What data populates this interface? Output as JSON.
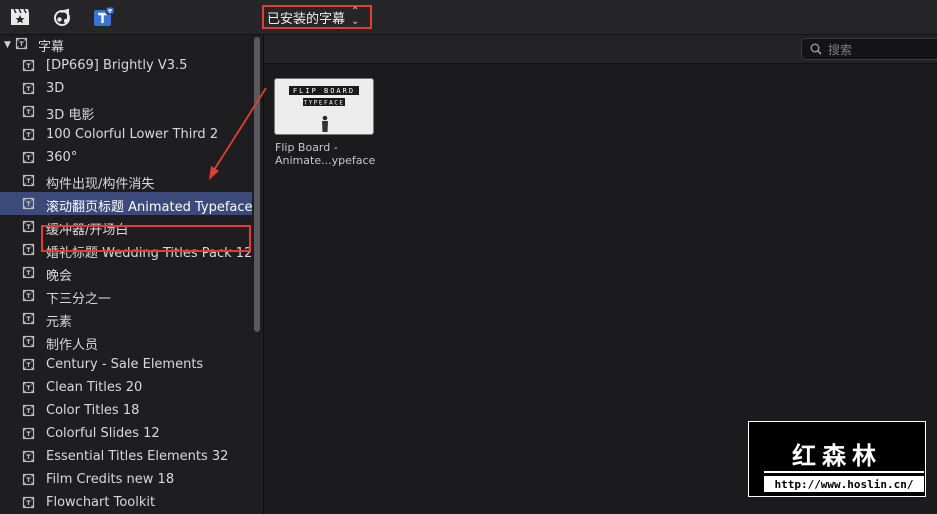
{
  "toolbar": {
    "icons": [
      "clapper-star-icon",
      "music-camera-icon",
      "titles-icon"
    ],
    "source_dropdown": "已安装的字幕",
    "accent_red": "#e23d2f"
  },
  "sidebar": {
    "header_label": "字幕",
    "items": [
      {
        "label": "[DP669] Brightly V3.5"
      },
      {
        "label": "3D"
      },
      {
        "label": "3D 电影"
      },
      {
        "label": "100 Colorful Lower Third 2"
      },
      {
        "label": "360°"
      },
      {
        "label": "构件出现/构件消失"
      },
      {
        "label": "滚动翻页标题 Animated Typeface",
        "selected": true
      },
      {
        "label": "缓冲器/开场白"
      },
      {
        "label": "婚礼标题 Wedding Titles Pack 12"
      },
      {
        "label": "晚会"
      },
      {
        "label": "下三分之一"
      },
      {
        "label": "元素"
      },
      {
        "label": "制作人员"
      },
      {
        "label": "Century - Sale Elements"
      },
      {
        "label": "Clean Titles 20"
      },
      {
        "label": "Color Titles 18"
      },
      {
        "label": "Colorful Slides 12"
      },
      {
        "label": "Essential Titles Elements 32"
      },
      {
        "label": "Film Credits new 18"
      },
      {
        "label": "Flowchart Toolkit"
      }
    ],
    "selected_color": "#3b4a7a"
  },
  "browser": {
    "search_placeholder": "搜索",
    "clips": [
      {
        "caption_line1": "Flip Board -",
        "caption_line2": "Animate...ypeface",
        "thumb_text_1": "FLIP BOARD",
        "thumb_text_2": "TYPEFACE"
      }
    ]
  },
  "watermark": {
    "title": "红森林",
    "url": "http://www.hoslin.cn/"
  }
}
